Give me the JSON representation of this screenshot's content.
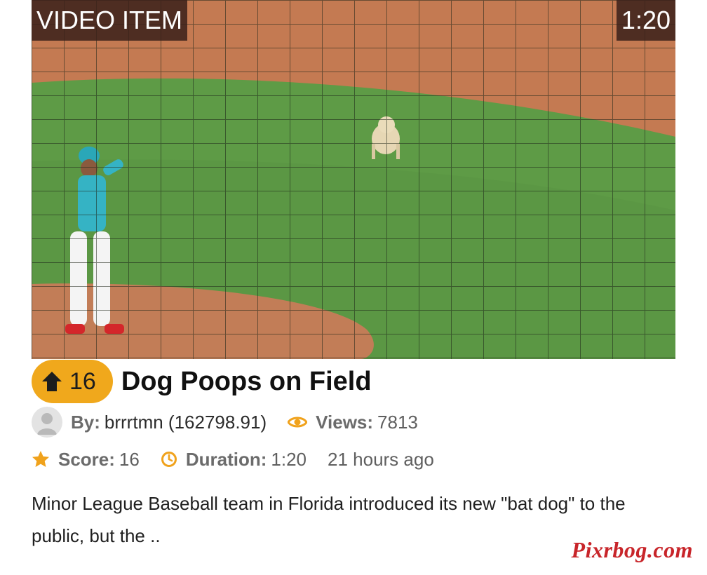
{
  "video": {
    "type_badge": "VIDEO ITEM",
    "duration_badge": "1:20",
    "thumbnail_alt": "dog-on-baseball-field"
  },
  "post": {
    "vote_count": "16",
    "title": "Dog Poops on Field"
  },
  "meta": {
    "by_label": "By:",
    "author": "brrrtmn (162798.91)",
    "views_label": "Views:",
    "views_value": "7813",
    "score_label": "Score:",
    "score_value": "16",
    "duration_label": "Duration:",
    "duration_value": "1:20",
    "time_ago": "21 hours ago"
  },
  "description": "Minor League Baseball team in Florida introduced its new \"bat dog\" to the public, but the ..",
  "watermark": "Pixrbog.com",
  "icons": {
    "vote": "arrow-up-icon",
    "views": "eye-icon",
    "score": "star-icon",
    "duration": "clock-icon",
    "avatar": "user-avatar-icon"
  },
  "colors": {
    "accent": "#f0a21c",
    "vote_pill": "#f0a81c",
    "watermark": "#c8252a",
    "badge_bg": "#3a201a",
    "field_green": "#5c9a45",
    "dirt": "#c47a52"
  }
}
